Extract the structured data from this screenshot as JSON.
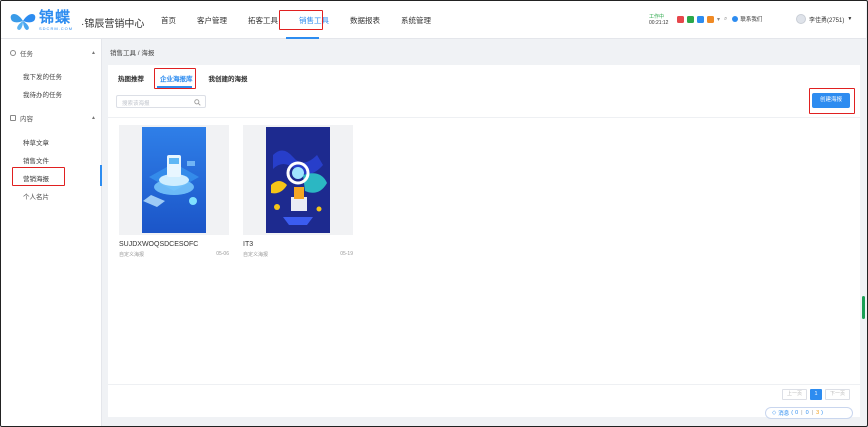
{
  "header": {
    "logo_text": "锦蝶",
    "logo_sub": "SDCRM.COM",
    "brand": "·锦辰营销中心",
    "nav": [
      "首页",
      "客户管理",
      "拓客工具",
      "销售工具",
      "数据报表",
      "系统管理"
    ],
    "active_nav": "销售工具",
    "timer_label": "工作中",
    "timer_value": "00:21:12",
    "contact_label": "联系我们",
    "user_name": "李佳勇(2751)",
    "status_colors": [
      "#e6474b",
      "#2ba84a",
      "#2d8cf0",
      "#f08a24"
    ]
  },
  "sidebar": {
    "group1": "任务",
    "group1_items": [
      "我下发的任务",
      "我待办的任务"
    ],
    "group2": "内容",
    "group2_items": [
      "种草文章",
      "销售文件",
      "营销海报",
      "个人名片"
    ],
    "active_item": "营销海报"
  },
  "breadcrumb": "销售工具 / 海报",
  "tabs": [
    "热图推荐",
    "企业海报库",
    "我创建的海报"
  ],
  "active_tab": "企业海报库",
  "search": {
    "placeholder": "搜索该海报"
  },
  "create_button": "创建海报",
  "posters": [
    {
      "title": "SUJDXWOQSDCESOFC",
      "source": "自定义海报",
      "date": "05-06"
    },
    {
      "title": "IT3",
      "source": "自定义海报",
      "date": "05-19"
    }
  ],
  "pagination": {
    "prev": "上一页",
    "page": "1",
    "next": "下一页"
  },
  "messages": {
    "label": "消息",
    "a": "0",
    "b": "0",
    "c": "3"
  }
}
